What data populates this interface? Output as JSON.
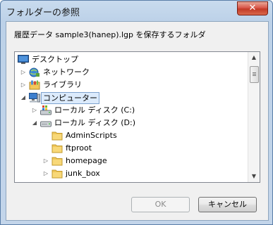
{
  "window": {
    "title": "フォルダーの参照",
    "close_label": "✕"
  },
  "description": "履歴データ sample3(hanep).lgp を保存するフォルダ",
  "tree": {
    "items": [
      {
        "label": "デスクトップ",
        "icon": "desktop-icon",
        "arrow": ""
      },
      {
        "label": "ネットワーク",
        "icon": "network-icon",
        "arrow": "collapsed"
      },
      {
        "label": "ライブラリ",
        "icon": "library-icon",
        "arrow": "collapsed"
      },
      {
        "label": "コンピューター",
        "icon": "computer-icon",
        "arrow": "expanded",
        "selected": true
      },
      {
        "label": "ローカル ディスク (C:)",
        "icon": "system-drive-icon",
        "arrow": "collapsed"
      },
      {
        "label": "ローカル ディスク (D:)",
        "icon": "drive-icon",
        "arrow": "expanded"
      },
      {
        "label": "AdminScripts",
        "icon": "folder-icon",
        "arrow": ""
      },
      {
        "label": "ftproot",
        "icon": "folder-icon",
        "arrow": ""
      },
      {
        "label": "homepage",
        "icon": "folder-icon",
        "arrow": "collapsed"
      },
      {
        "label": "junk_box",
        "icon": "folder-icon",
        "arrow": "collapsed"
      }
    ]
  },
  "buttons": {
    "ok_label": "OK",
    "cancel_label": "キャンセル"
  },
  "colors": {
    "selection_bg": "#dcebfc",
    "selection_border": "#7da2ce",
    "close_red": "#c23a26"
  }
}
